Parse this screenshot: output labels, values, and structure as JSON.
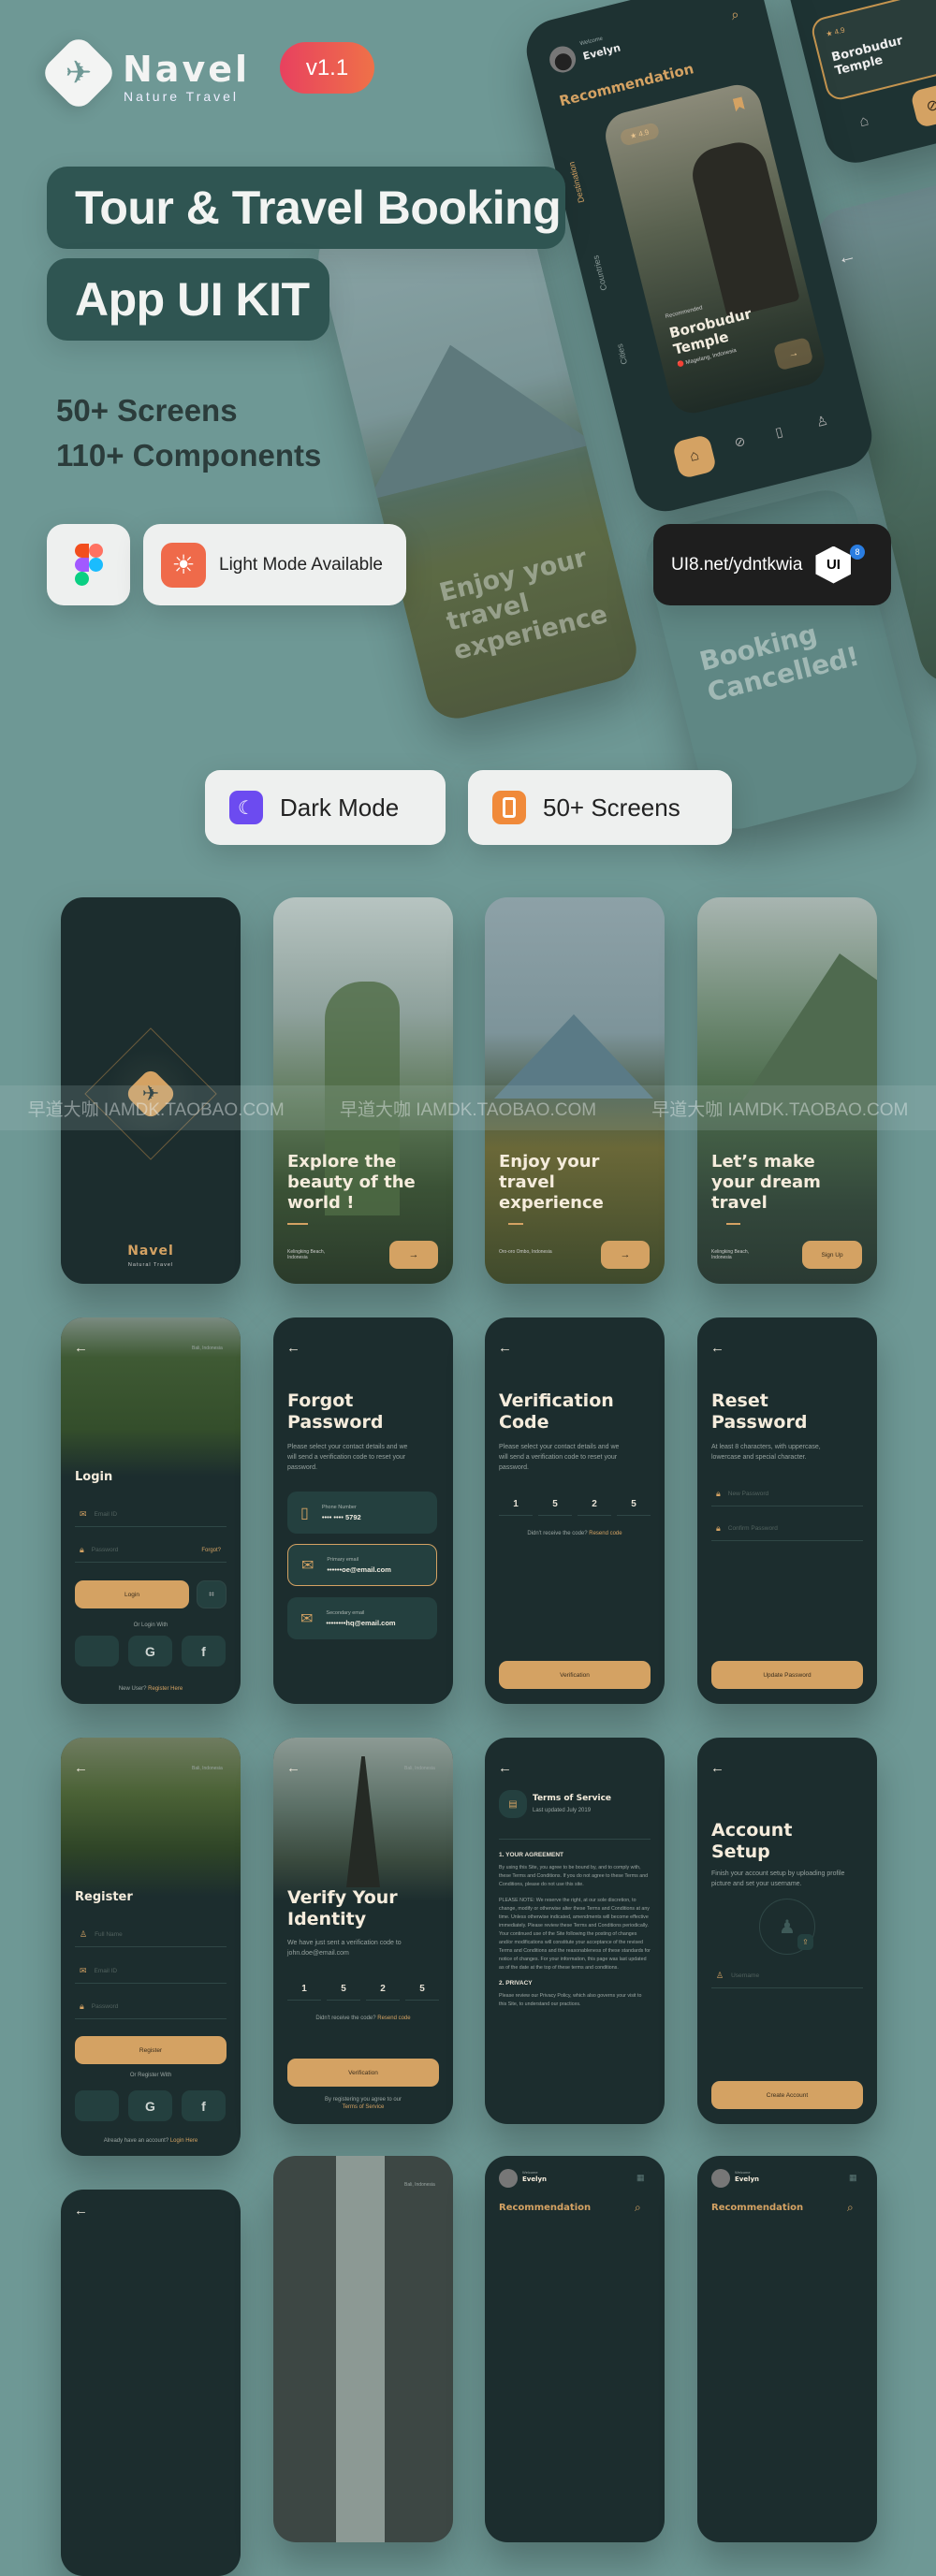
{
  "brand": {
    "name": "Navel",
    "tagline": "Nature Travel",
    "version": "v1.1"
  },
  "hero": {
    "title_line1": "Tour & Travel Booking",
    "title_line2": "App UI KIT",
    "stat_screens": "50+ Screens",
    "stat_components": "110+ Components",
    "light_mode": "Light Mode Available",
    "ui8_link": "UI8.net/ydntkwia",
    "ui8_logo": "UI",
    "ui8_badge": "8"
  },
  "showcase": {
    "welcome": "Welcome",
    "user": "Evelyn",
    "heading": "Recommendation",
    "tabs": [
      "Destination",
      "Countries",
      "Cities"
    ],
    "card": {
      "rating": "4.9",
      "label": "Recommended",
      "title": "Borobudur Temple",
      "location": "Magelang, Indonesia"
    },
    "mini_card": {
      "rating": "4.9",
      "title": "Borobudur Temple"
    },
    "landscape_text": "Enjoy your travel experience",
    "booking_text": "Booking Cancelled!"
  },
  "features": {
    "dark_mode": "Dark Mode",
    "screens": "50+ Screens"
  },
  "watermark": "早道大咖  IAMDK.TAOBAO.COM",
  "screens": {
    "splash": {
      "name": "Navel",
      "tagline": "Natural Travel"
    },
    "onboard1": {
      "title": "Explore the beauty of the world !",
      "location": "Kelingking Beach, Indonesia"
    },
    "onboard2": {
      "title": "Enjoy your travel experience",
      "location": "Oro-oro Ombo, Indonesia"
    },
    "onboard3": {
      "title": "Let’s make your dream travel",
      "location": "Kelingking Beach, Indonesia",
      "button": "Sign Up"
    },
    "login": {
      "location": "Bali, Indonesia",
      "title": "Login",
      "email_ph": "Email ID",
      "password_ph": "Password",
      "forgot": "Forgot?",
      "button": "Login",
      "or": "Or Login With",
      "footer": "New User?",
      "footer_link": "Register Here"
    },
    "forgot": {
      "title": "Forgot Password",
      "desc": "Please select your contact details and we will send a verification code to reset your password.",
      "options": [
        {
          "label": "Phone Number",
          "value": "•••• •••• 5792"
        },
        {
          "label": "Primary email",
          "value": "••••••oe@email.com"
        },
        {
          "label": "Secondary email",
          "value": "••••••••hq@email.com"
        }
      ]
    },
    "verification": {
      "title": "Verification Code",
      "desc": "Please select your contact details and we will send a verification code to reset your password.",
      "digits": [
        "1",
        "5",
        "2",
        "5"
      ],
      "resend_q": "Didn't receive the code?",
      "resend": "Resend code",
      "button": "Verification"
    },
    "reset": {
      "title": "Reset Password",
      "desc": "At least 8 characters, with uppercase, lowercase and special character.",
      "new_ph": "New Password",
      "confirm_ph": "Confirm Password",
      "button": "Update Password"
    },
    "register": {
      "location": "Bali, Indonesia",
      "title": "Register",
      "name_ph": "Full Name",
      "email_ph": "Email ID",
      "password_ph": "Password",
      "button": "Register",
      "or": "Or Register With",
      "footer": "Already have an account?",
      "footer_link": "Login Here"
    },
    "verify_identity": {
      "location": "Bali, Indonesia",
      "title": "Verify Your Identity",
      "desc": "We have just sent a verification code to john.doe@email.com",
      "digits": [
        "1",
        "5",
        "2",
        "5"
      ],
      "resend_q": "Didn't receive the code?",
      "resend": "Resend code",
      "button": "Verification",
      "agree": "By registering you agree to our",
      "agree_link": "Terms of Service"
    },
    "terms": {
      "title": "Terms of Service",
      "updated": "Last updated July 2019",
      "s1": "1. YOUR AGREEMENT",
      "p1": "By using this Site, you agree to be bound by, and to comply with, these Terms and Conditions. If you do not agree to these Terms and Conditions, please do not use this site.",
      "p2": "PLEASE NOTE: We reserve the right, at our sole discretion, to change, modify or otherwise alter these Terms and Conditions at any time. Unless otherwise indicated, amendments will become effective immediately. Please review these Terms and Conditions periodically. Your continued use of the Site following the posting of changes and/or modifications will constitute your acceptance of the revised Terms and Conditions and the reasonableness of these standards for notice of changes. For your information, this page was last updated as of the date at the top of these terms and conditions.",
      "s2": "2. PRIVACY",
      "p3": "Please review our Privacy Policy, which also governs your visit to this Site, to understand our practices."
    },
    "account": {
      "title": "Account Setup",
      "desc": "Finish your account setup by uploading profile picture and set your username.",
      "username_ph": "Username",
      "button": "Create Account"
    },
    "home": {
      "welcome": "Welcome",
      "user": "Evelyn",
      "heading": "Recommendation"
    },
    "gate": {
      "location": "Bali, Indonesia"
    }
  },
  "colors": {
    "background": "#6e9895",
    "phone": "#1c2d2e",
    "accent": "#d4a263",
    "pill": "#2f5552",
    "badge_start": "#e8415f",
    "badge_end": "#ef7148"
  }
}
